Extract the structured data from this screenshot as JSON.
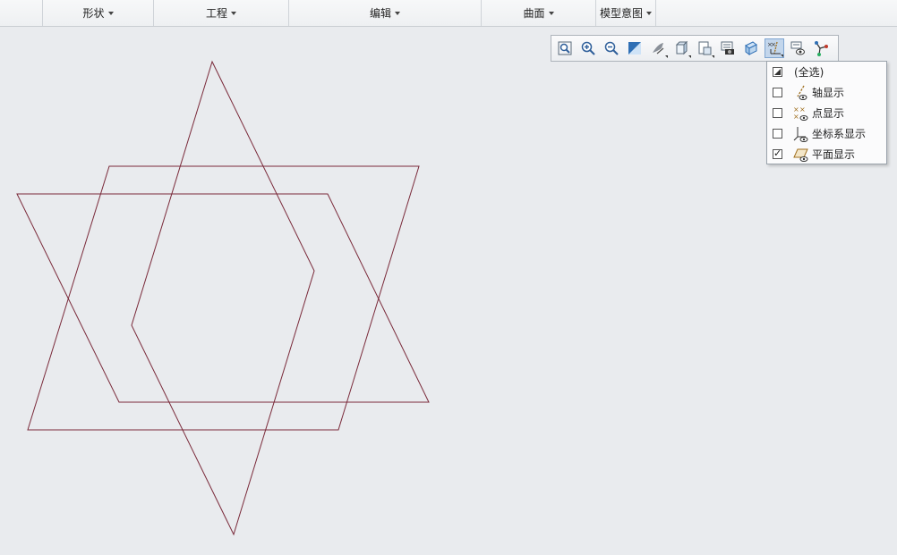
{
  "ribbon": {
    "groups": [
      {
        "label": "形状"
      },
      {
        "label": "工程"
      },
      {
        "label": "编辑"
      },
      {
        "label": "曲面"
      },
      {
        "label": "模型意图"
      }
    ]
  },
  "view_toolbar": {
    "buttons": [
      "refit-icon",
      "zoom-in-icon",
      "zoom-out-icon",
      "repaint-icon",
      "perspective-icon",
      "display-style-icon",
      "saved-views-icon",
      "view-manager-icon",
      "section-icon",
      "datum-display-filters-icon",
      "annotation-display-icon",
      "spin-center-icon"
    ],
    "active": "datum-display-filters-icon"
  },
  "datum_filter_menu": {
    "items": [
      {
        "label": "(全选)",
        "state": "partial",
        "icon": ""
      },
      {
        "label": "轴显示",
        "state": "unchecked",
        "icon": "axis-display-icon"
      },
      {
        "label": "点显示",
        "state": "unchecked",
        "icon": "point-display-icon"
      },
      {
        "label": "坐标系显示",
        "state": "unchecked",
        "icon": "csys-display-icon"
      },
      {
        "label": "平面显示",
        "state": "checked",
        "icon": "plane-display-icon"
      }
    ]
  },
  "colors": {
    "sketch_line": "#7a2a3a",
    "background": "#e9ebee",
    "toolbar_active": "#c3d6ec"
  }
}
